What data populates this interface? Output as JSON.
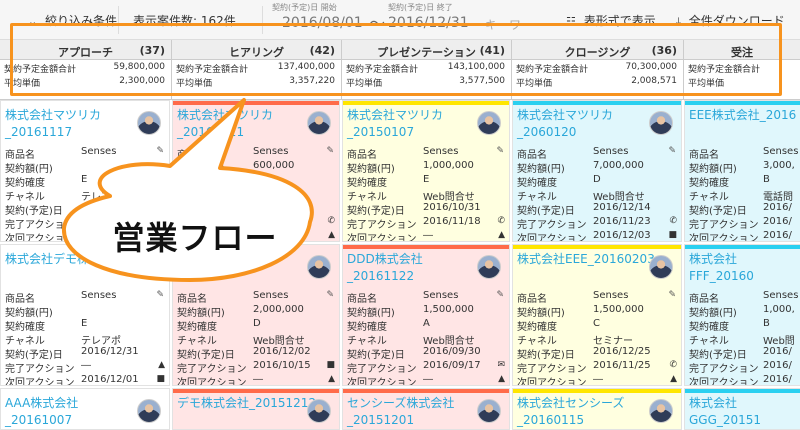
{
  "toolbar": {
    "filter_label": "絞り込み条件",
    "count_label": "表示案件数: 162件",
    "start_label": "契約(予定)日 開始",
    "start_value": "2016/08/01",
    "end_label": "契約(予定)日 終了",
    "end_value": "2016/12/31",
    "tilde": "〜",
    "keyword_placeholder": "キーワ",
    "table_view": "表形式で表示",
    "download_all": "全件ダウンロード"
  },
  "stages": [
    {
      "name": "アプローチ",
      "count": "(37)",
      "total_label": "契約予定金額合計",
      "total": "59,800,000",
      "avg_label": "平均単価",
      "avg": "2,300,000"
    },
    {
      "name": "ヒアリング",
      "count": "(42)",
      "total_label": "契約予定金額合計",
      "total": "137,400,000",
      "avg_label": "平均単価",
      "avg": "3,357,220"
    },
    {
      "name": "プレゼンテーション",
      "count": "(41)",
      "total_label": "契約予定金額合計",
      "total": "143,100,000",
      "avg_label": "平均単価",
      "avg": "3,577,500"
    },
    {
      "name": "クロージング",
      "count": "(36)",
      "total_label": "契約予定金額合計",
      "total": "70,300,000",
      "avg_label": "平均単価",
      "avg": "2,008,571"
    },
    {
      "name": "受注",
      "count": "",
      "total_label": "契約予定金額合計",
      "total": "",
      "avg_label": "平均単価",
      "avg": ""
    }
  ],
  "labels": {
    "product": "商品名",
    "amount": "契約額(円)",
    "certainty": "契約確度",
    "channel": "チャネル",
    "date": "契約(予定)日",
    "done": "完了アクション",
    "next": "次回アクション"
  },
  "cards": {
    "r1c1": {
      "title1": "株式会社マツリカ",
      "title2": "_20161117",
      "product": "Senses",
      "amount": "",
      "certainty": "E",
      "channel": "テレアポ",
      "date": "",
      "done": "",
      "next": ""
    },
    "r1c2": {
      "title1": "株式会社マツリカ",
      "title2": "_20160121",
      "product": "Senses",
      "amount": "600,000",
      "certainty": "B",
      "channel": "",
      "date": "2016/10/31",
      "done": "",
      "next": ""
    },
    "r1c3": {
      "title1": "株式会社マツリカ",
      "title2": "_20150107",
      "product": "Senses",
      "amount": "1,000,000",
      "certainty": "E",
      "channel": "Web問合せ",
      "date": "2016/10/31",
      "done": "2016/11/18",
      "next": "―"
    },
    "r1c4": {
      "title1": "株式会社マツリカ",
      "title2": "_2060120",
      "product": "Senses",
      "amount": "7,000,000",
      "certainty": "D",
      "channel": "Web問合せ",
      "date": "2016/12/14",
      "done": "2016/11/23",
      "next": "2016/12/03"
    },
    "r1c5": {
      "title1": "EEE株式会社_2016",
      "title2": "",
      "product": "Senses",
      "amount": "3,000,",
      "certainty": "B",
      "channel": "電話問",
      "date": "2016/",
      "done": "2016/",
      "next": "2016/"
    },
    "r2c1": {
      "title1": "株式会社デモ株式会社",
      "title2": "",
      "product": "Senses",
      "amount": "",
      "certainty": "E",
      "channel": "テレアポ",
      "date": "2016/12/31",
      "done": "―",
      "next": "2016/12/01"
    },
    "r2c2": {
      "title1": "",
      "title2": "",
      "product": "Senses",
      "amount": "2,000,000",
      "certainty": "D",
      "channel": "Web問合せ",
      "date": "2016/12/02",
      "done": "2016/10/15",
      "next": "―"
    },
    "r2c3": {
      "title1": "DDD株式会社",
      "title2": "_20161122",
      "product": "Senses",
      "amount": "1,500,000",
      "certainty": "A",
      "channel": "Web問合せ",
      "date": "2016/09/30",
      "done": "2016/09/17",
      "next": "―"
    },
    "r2c4": {
      "title1": "株式会社EEE_20160203",
      "title2": "",
      "product": "Senses",
      "amount": "1,500,000",
      "certainty": "C",
      "channel": "セミナー",
      "date": "2016/12/25",
      "done": "2016/11/25",
      "next": "―"
    },
    "r2c5": {
      "title1": "株式会社FFF_20160",
      "title2": "",
      "product": "Senses",
      "amount": "1,000,",
      "certainty": "B",
      "channel": "Web問",
      "date": "2016/",
      "done": "2016/",
      "next": "2016/"
    },
    "r3c1": {
      "title1": "AAA株式会社",
      "title2": "_20161007"
    },
    "r3c2": {
      "title1": "デモ株式会社_20151212",
      "title2": ""
    },
    "r3c3": {
      "title1": "センシーズ株式会社",
      "title2": "_20151201"
    },
    "r3c4": {
      "title1": "株式会社センシーズ",
      "title2": "_20160115"
    },
    "r3c5": {
      "title1": "株式会社GGG_20151",
      "title2": ""
    }
  },
  "callout": {
    "text": "営業フロー"
  },
  "colors": {
    "accent": "#f7931e",
    "link": "#2aa7d9",
    "red": "#ff6b4a",
    "yellow": "#ffe600",
    "blue": "#2ad0f0"
  }
}
